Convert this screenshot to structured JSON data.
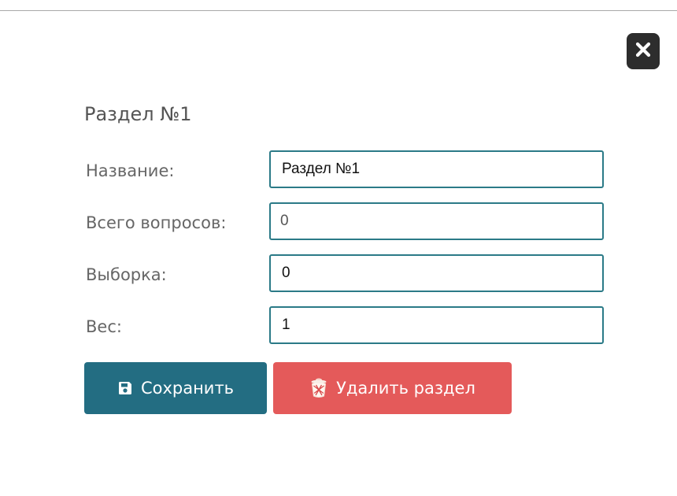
{
  "dialog": {
    "section_title": "Раздел №1",
    "close_icon": "close-x-icon",
    "fields": [
      {
        "label": "Название:",
        "value": "Раздел №1"
      },
      {
        "label": "Всего вопросов:",
        "value": "0"
      },
      {
        "label": "Выборка:",
        "value": "0"
      },
      {
        "label": "Вес:",
        "value": "1"
      }
    ],
    "buttons": {
      "save_label": "Сохранить",
      "save_icon": "floppy-disk-icon",
      "delete_label": "Удалить раздел",
      "delete_icon": "trash-bin-icon"
    }
  },
  "colors": {
    "save_button": "#236d82",
    "delete_button": "#e45a5a",
    "input_border": "#2b7a87",
    "close_button": "#2d2d2d"
  }
}
